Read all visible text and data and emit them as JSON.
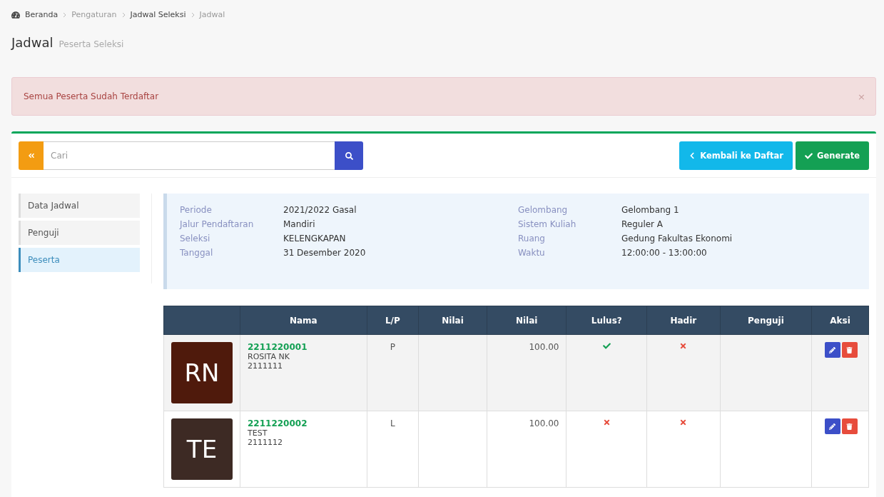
{
  "breadcrumb": [
    {
      "label": "Beranda",
      "kind": "home"
    },
    {
      "label": "Pengaturan",
      "kind": "muted"
    },
    {
      "label": "Jadwal Seleksi",
      "kind": "link"
    },
    {
      "label": "Jadwal",
      "kind": "muted"
    }
  ],
  "title": "Jadwal",
  "subtitle": "Peserta Seleksi",
  "alert": {
    "message": "Semua Peserta Sudah Terdaftar",
    "close": "×"
  },
  "search": {
    "placeholder": "Cari"
  },
  "buttons": [
    {
      "label": "Kembali ke Daftar",
      "kind": "back"
    },
    {
      "label": "Generate",
      "kind": "generate"
    }
  ],
  "sidebar": {
    "items": [
      {
        "label": "Data Jadwal",
        "selected": false
      },
      {
        "label": "Penguji",
        "selected": false
      },
      {
        "label": "Peserta",
        "selected": true
      }
    ]
  },
  "info": [
    {
      "label": "Periode",
      "value": "2021/2022 Gasal"
    },
    {
      "label": "Jalur Pendaftaran",
      "value": "Mandiri"
    },
    {
      "label": "Seleksi",
      "value": "KELENGKAPAN"
    },
    {
      "label": "Tanggal",
      "value": "31 Desember 2020"
    },
    {
      "label": "Gelombang",
      "value": "Gelombang 1"
    },
    {
      "label": "Sistem Kuliah",
      "value": "Reguler A"
    },
    {
      "label": "Ruang",
      "value": "Gedung Fakultas Ekonomi"
    },
    {
      "label": "Waktu",
      "value": "12:00:00 - 13:00:00"
    }
  ],
  "table": {
    "columns": [
      "Nama",
      "L/P",
      "Nilai",
      "Nilai",
      "Lulus?",
      "Hadir",
      "Penguji",
      "Aksi"
    ],
    "rows": [
      {
        "initials": "RN",
        "color": "#4f1a0c",
        "number": "2211220001",
        "name": "ROSITA NK",
        "code": "2111111",
        "gender": "P",
        "score": "100.00",
        "passed": true,
        "present": false
      },
      {
        "initials": "TE",
        "color": "#3d2a24",
        "number": "2211220002",
        "name": "TEST",
        "code": "2111112",
        "gender": "L",
        "score": "100.00",
        "passed": false,
        "present": false
      }
    ]
  }
}
